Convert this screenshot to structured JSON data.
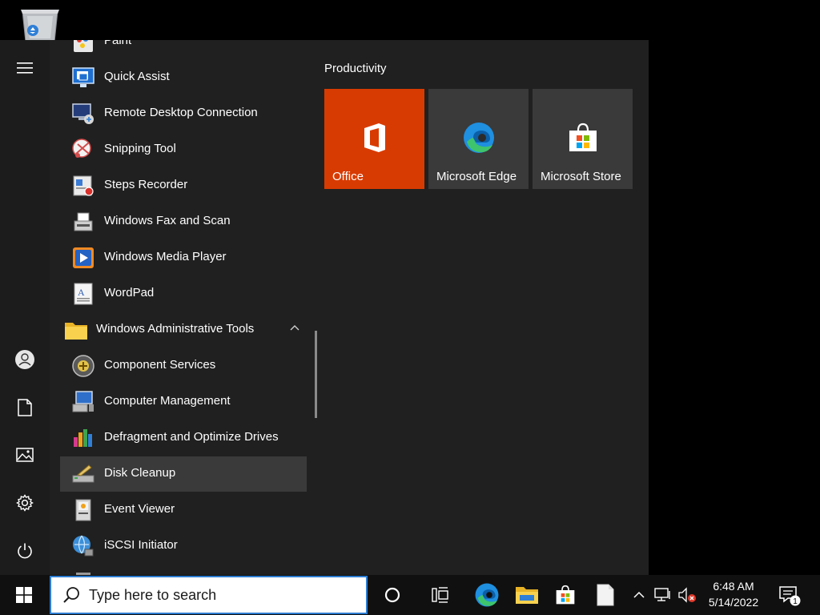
{
  "desktop": {
    "recycle_bin_icon": "recycle-bin-icon"
  },
  "start_menu": {
    "rail": {
      "menu_icon": "hamburger-icon",
      "user_icon": "user-icon",
      "documents_icon": "document-icon",
      "pictures_icon": "pictures-icon",
      "settings_icon": "gear-icon",
      "power_icon": "power-icon"
    },
    "apps": [
      {
        "label": "Paint",
        "icon": "paint-icon"
      },
      {
        "label": "Quick Assist",
        "icon": "quick-assist-icon"
      },
      {
        "label": "Remote Desktop Connection",
        "icon": "remote-desktop-icon"
      },
      {
        "label": "Snipping Tool",
        "icon": "snipping-tool-icon"
      },
      {
        "label": "Steps Recorder",
        "icon": "steps-recorder-icon"
      },
      {
        "label": "Windows Fax and Scan",
        "icon": "fax-scan-icon"
      },
      {
        "label": "Windows Media Player",
        "icon": "media-player-icon"
      },
      {
        "label": "WordPad",
        "icon": "wordpad-icon"
      },
      {
        "label": "Windows Administrative Tools",
        "icon": "folder-icon",
        "group": true,
        "expanded": true
      },
      {
        "label": "Component Services",
        "icon": "component-services-icon"
      },
      {
        "label": "Computer Management",
        "icon": "computer-management-icon"
      },
      {
        "label": "Defragment and Optimize Drives",
        "icon": "defrag-icon"
      },
      {
        "label": "Disk Cleanup",
        "icon": "disk-cleanup-icon",
        "hovered": true
      },
      {
        "label": "Event Viewer",
        "icon": "event-viewer-icon"
      },
      {
        "label": "iSCSI Initiator",
        "icon": "iscsi-icon"
      }
    ],
    "tiles_group_title": "Productivity",
    "tiles": [
      {
        "label": "Office",
        "icon": "office-icon",
        "color": "#d83b01"
      },
      {
        "label": "Microsoft Edge",
        "icon": "edge-icon",
        "color": "#3a3a3a"
      },
      {
        "label": "Microsoft Store",
        "icon": "store-icon",
        "color": "#3a3a3a"
      }
    ]
  },
  "taskbar": {
    "start_icon": "windows-logo-icon",
    "search_placeholder": "Type here to search",
    "cortana_icon": "cortana-circle-icon",
    "task_view_icon": "task-view-icon",
    "pinned": [
      "edge-icon",
      "file-explorer-icon",
      "store-icon",
      "blank-document-icon"
    ],
    "tray": {
      "chevron_icon": "chevron-up-icon",
      "network_icon": "network-icon",
      "volume_icon": "volume-muted-icon"
    },
    "clock": {
      "time": "6:48 AM",
      "date": "5/14/2022"
    },
    "notifications": {
      "icon": "action-center-icon",
      "count": "1"
    }
  },
  "colors": {
    "start_bg": "#202020",
    "taskbar_bg": "#101010",
    "accent_office": "#d83b01",
    "tile_bg": "#3a3a3a",
    "search_border": "#2d7dd2"
  }
}
